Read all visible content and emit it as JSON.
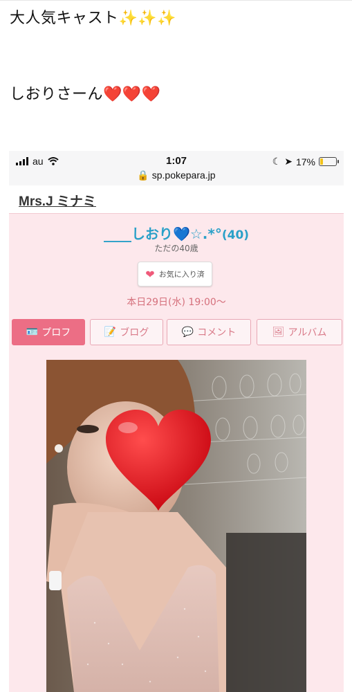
{
  "post": {
    "line1_text": "大人気キャスト",
    "line1_emoji": "✨✨✨",
    "line2_text": "しおりさーん",
    "line2_emoji": "❤️❤️❤️"
  },
  "phone": {
    "status_bar": {
      "carrier": "au",
      "time": "1:07",
      "battery": "17%",
      "battery_level": 0.17
    },
    "url": "sp.pokepara.jp",
    "shop_title": "Mrs.J ミナミ",
    "cast": {
      "name_prefix": "____しおり",
      "name_suffix": "☆.*°",
      "age": "(40)",
      "subtitle": "ただの40歳"
    },
    "favorite_label": "お気に入り済",
    "schedule": "本日29日(水) 19:00〜",
    "tabs": [
      {
        "label": "プロフ",
        "icon": "profile-card-icon",
        "active": true
      },
      {
        "label": "ブログ",
        "icon": "blog-note-icon",
        "active": false
      },
      {
        "label": "コメント",
        "icon": "comment-bubble-icon",
        "active": false
      },
      {
        "label": "アルバム",
        "icon": "album-photo-icon",
        "active": false
      }
    ]
  },
  "colors": {
    "accent_pink": "#ec6e85",
    "cast_name_blue": "#2aa0c8",
    "schedule_pink": "#d5707c",
    "page_pink": "#fde8ec"
  }
}
